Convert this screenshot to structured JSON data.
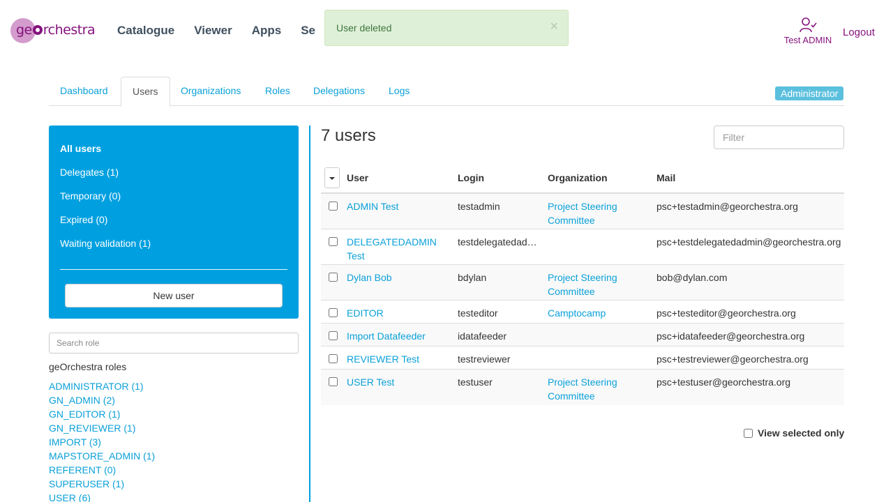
{
  "brand": {
    "logo_alt": "geOrchestra",
    "logo_pre": "ge",
    "logo_post": "rchestra"
  },
  "nav": {
    "items": [
      "Catalogue",
      "Viewer",
      "Apps",
      "Se"
    ]
  },
  "user": {
    "name": "Test ADMIN",
    "logout": "Logout"
  },
  "toast": {
    "message": "User deleted",
    "close": "×"
  },
  "tabs": [
    "Dashboard",
    "Users",
    "Organizations",
    "Roles",
    "Delegations",
    "Logs"
  ],
  "active_tab": "Users",
  "role_badge": "Administrator",
  "sidebar": {
    "items": [
      "All users",
      "Delegates (1)",
      "Temporary (0)",
      "Expired (0)",
      "Waiting validation (1)"
    ],
    "new_user": "New user",
    "search_placeholder": "Search role",
    "roles_title": "geOrchestra roles",
    "roles": [
      "ADMINISTRATOR (1)",
      "GN_ADMIN (2)",
      "GN_EDITOR (1)",
      "GN_REVIEWER (1)",
      "IMPORT (3)",
      "MAPSTORE_ADMIN (1)",
      "REFERENT (0)",
      "SUPERUSER (1)",
      "USER (6)"
    ]
  },
  "main": {
    "count": "7 users",
    "filter_placeholder": "Filter",
    "columns": {
      "user": "User",
      "login": "Login",
      "organization": "Organization",
      "mail": "Mail"
    },
    "rows": [
      {
        "user": "ADMIN Test",
        "login": "testadmin",
        "org": "Project Steering Committee",
        "mail": "psc+testadmin@georchestra.org"
      },
      {
        "user": "DELEGATEDADMIN Test",
        "login": "testdelegatedadmin",
        "org": "",
        "mail": "psc+testdelegatedadmin@georchestra.org"
      },
      {
        "user": "Dylan Bob",
        "login": "bdylan",
        "org": "Project Steering Committee",
        "mail": "bob@dylan.com"
      },
      {
        "user": "EDITOR",
        "login": "testeditor",
        "org": "Camptocamp",
        "mail": "psc+testeditor@georchestra.org"
      },
      {
        "user": "Import Datafeeder",
        "login": "idatafeeder",
        "org": "",
        "mail": "psc+idatafeeder@georchestra.org"
      },
      {
        "user": "REVIEWER Test",
        "login": "testreviewer",
        "org": "",
        "mail": "psc+testreviewer@georchestra.org"
      },
      {
        "user": "USER Test",
        "login": "testuser",
        "org": "Project Steering Committee",
        "mail": "psc+testuser@georchestra.org"
      }
    ],
    "view_selected": "View selected only"
  },
  "colors": {
    "accent": "#00a0e0",
    "link": "#0aa0d8",
    "brand": "#85127e",
    "toast_bg": "#dff0d8"
  }
}
